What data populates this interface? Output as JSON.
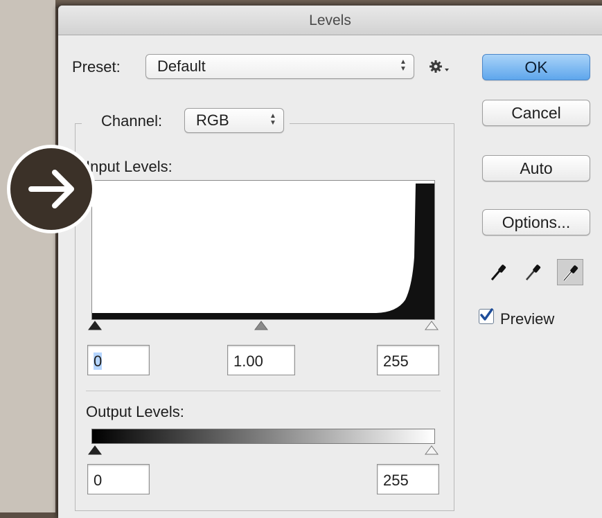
{
  "window": {
    "title": "Levels"
  },
  "preset": {
    "label": "Preset:",
    "value": "Default"
  },
  "channel": {
    "label": "Channel:",
    "value": "RGB"
  },
  "input_levels": {
    "label": "Input Levels:",
    "black_value": "0",
    "gamma_value": "1.00",
    "white_value": "255"
  },
  "output_levels": {
    "label": "Output Levels:",
    "black_value": "0",
    "white_value": "255"
  },
  "buttons": {
    "ok": "OK",
    "cancel": "Cancel",
    "auto": "Auto",
    "options": "Options..."
  },
  "preview": {
    "label": "Preview",
    "checked": true
  },
  "icons": {
    "preset_options": "gear-icon",
    "black_eyedropper": "black-point-eyedropper-icon",
    "gray_eyedropper": "gray-point-eyedropper-icon",
    "white_eyedropper": "white-point-eyedropper-icon",
    "overlay": "arrow-right-icon"
  },
  "colors": {
    "ok_button": "#5ea6ec",
    "dialog_bg": "#ececec",
    "overlay_circle": "#3b3128"
  }
}
